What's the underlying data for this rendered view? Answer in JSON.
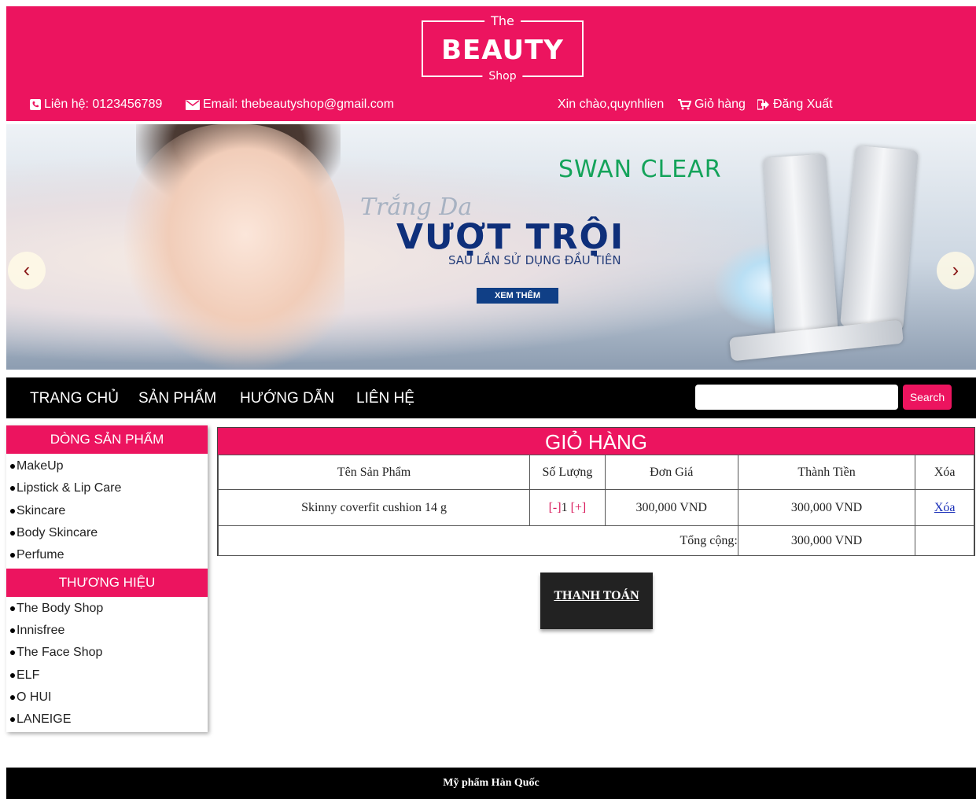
{
  "header": {
    "logo": {
      "top": "The",
      "main": "BEAUTY",
      "bottom": "Shop"
    },
    "phone": "Liên hệ: 0123456789",
    "email": "Email: thebeautyshop@gmail.com",
    "greeting": "Xin chào,quynhlien",
    "cart_label": "Giỏ hàng",
    "logout_label": "Đăng Xuất",
    "color": "#ec145f"
  },
  "banner": {
    "brand": "SWAN CLEAR",
    "script": "Trắng Da",
    "headline": "VƯỢT TRỘI",
    "subline": "SAU LẦN SỬ DỤNG ĐẦU TIÊN",
    "button": "XEM THÊM",
    "prev": "‹",
    "next": "›"
  },
  "nav": {
    "items": [
      "TRANG CHỦ",
      "SẢN PHẨM",
      "HƯỚNG DẪN",
      "LIÊN HỆ"
    ],
    "search_placeholder": "",
    "search_button": "Search"
  },
  "sidebar": {
    "categories_title": "DÒNG SẢN PHẨM",
    "categories": [
      "MakeUp",
      "Lipstick & Lip Care",
      "Skincare",
      "Body Skincare",
      "Perfume"
    ],
    "brands_title": "THƯƠNG HIỆU",
    "brands": [
      "The Body Shop",
      "Innisfree",
      "The Face Shop",
      "ELF",
      "O HUI",
      "LANEIGE"
    ]
  },
  "cart": {
    "title": "GIỎ HÀNG",
    "headers": [
      "Tên Sản Phẩm",
      "Số Lượng",
      "Đơn Giá",
      "Thành Tiền",
      "Xóa"
    ],
    "row": {
      "name": "Skinny coverfit cushion 14 g",
      "minus": "[-]",
      "qty": "1",
      "plus": "[+]",
      "price": "300,000 VND",
      "total": "300,000 VND",
      "delete": "Xóa"
    },
    "sum_label": "Tổng cộng:",
    "sum_value": "300,000 VND"
  },
  "checkout": "THANH TOÁN",
  "footer": "Mỹ phẩm Hàn Quốc"
}
